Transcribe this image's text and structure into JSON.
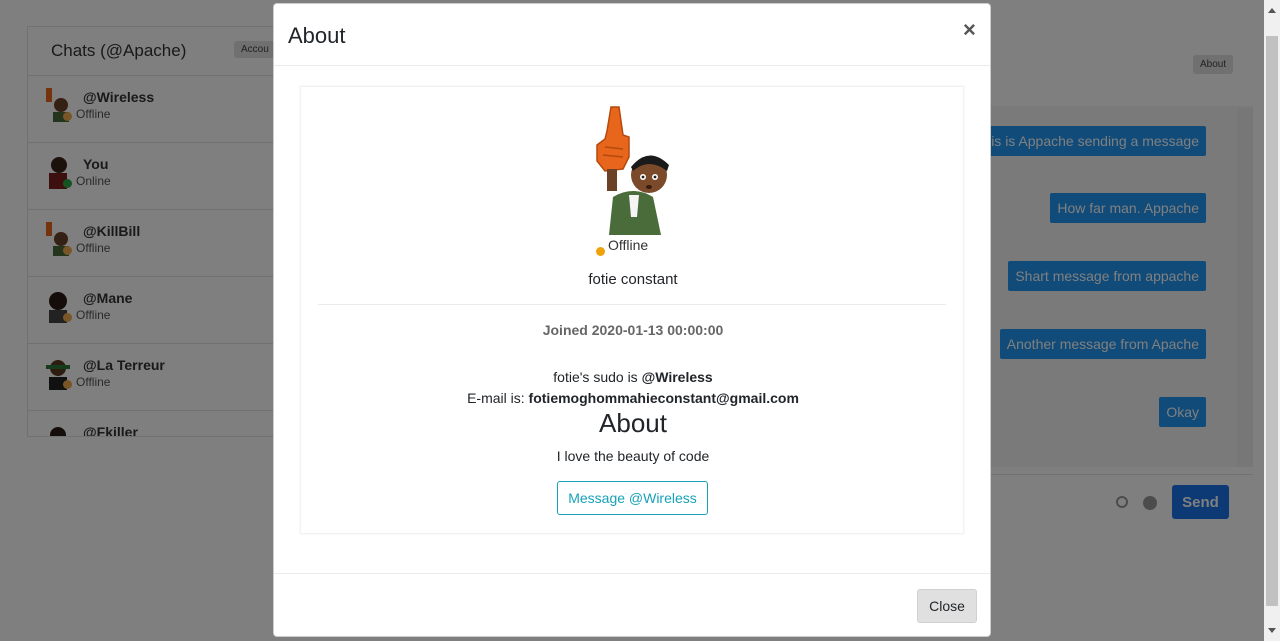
{
  "chats": {
    "title": "Chats (@Apache)",
    "account_btn": "Accou",
    "contacts": [
      {
        "name": "@Wireless",
        "status": "Offline",
        "status_color": "#f0ad4e"
      },
      {
        "name": "You",
        "status": "Online",
        "status_color": "#28a745"
      },
      {
        "name": "@KillBill",
        "status": "Offline",
        "status_color": "#f0ad4e"
      },
      {
        "name": "@Mane",
        "status": "Offline",
        "status_color": "#f0ad4e"
      },
      {
        "name": "@La Terreur",
        "status": "Offline",
        "status_color": "#f0ad4e"
      },
      {
        "name": "@Fkiller",
        "status": "",
        "status_color": "#f0ad4e"
      }
    ]
  },
  "conversation": {
    "about_btn": "About",
    "messages": [
      "This is Appache sending a message",
      "How far man. Appache",
      "Shart message from appache",
      "Another message from Apache",
      "Okay"
    ],
    "send_label": "Send"
  },
  "modal": {
    "title": "About",
    "close_x": "×",
    "status": "Offline",
    "status_color": "#f0a20a",
    "full_name": "fotie constant",
    "joined": "Joined 2020-01-13 00:00:00",
    "sudo_prefix": "fotie's sudo is ",
    "sudo_value": "@Wireless",
    "email_prefix": "E-mail is: ",
    "email_value": "fotiemoghommahieconstant@gmail.com",
    "about_heading": "About",
    "bio": "I love the beauty of code",
    "message_btn": "Message @Wireless",
    "close_btn": "Close"
  },
  "colors": {
    "bubble": "#2196f3",
    "send": "#1a73e8",
    "accent_outline": "#17a2b8",
    "backdrop": "rgba(0,0,0,0.5)"
  }
}
